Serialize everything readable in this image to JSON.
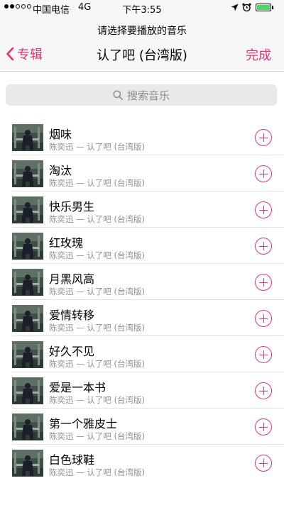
{
  "status_bar": {
    "carrier": "中国电信",
    "network": "4G",
    "time": "下午3:55",
    "battery_level": 1.0
  },
  "header": {
    "prompt": "请选择要播放的音乐",
    "back_label": "专辑",
    "title": "认了吧 (台湾版)",
    "done_label": "完成"
  },
  "search": {
    "placeholder": "搜索音乐"
  },
  "songs": [
    {
      "title": "烟味",
      "subtitle": "陈奕迅 — 认了吧 (台湾版)"
    },
    {
      "title": "淘汰",
      "subtitle": "陈奕迅 — 认了吧 (台湾版)"
    },
    {
      "title": "快乐男生",
      "subtitle": "陈奕迅 — 认了吧 (台湾版)"
    },
    {
      "title": "红玫瑰",
      "subtitle": "陈奕迅 — 认了吧 (台湾版)"
    },
    {
      "title": "月黑风高",
      "subtitle": "陈奕迅 — 认了吧 (台湾版)"
    },
    {
      "title": "爱情转移",
      "subtitle": "陈奕迅 — 认了吧 (台湾版)"
    },
    {
      "title": "好久不见",
      "subtitle": "陈奕迅 — 认了吧 (台湾版)"
    },
    {
      "title": "爱是一本书",
      "subtitle": "陈奕迅 — 认了吧 (台湾版)"
    },
    {
      "title": "第一个雅皮士",
      "subtitle": "陈奕迅 — 认了吧 (台湾版)"
    },
    {
      "title": "白色球鞋",
      "subtitle": "陈奕迅 — 认了吧 (台湾版)"
    }
  ],
  "colors": {
    "accent": "#e8336c",
    "secondary_text": "#8e8e93"
  }
}
